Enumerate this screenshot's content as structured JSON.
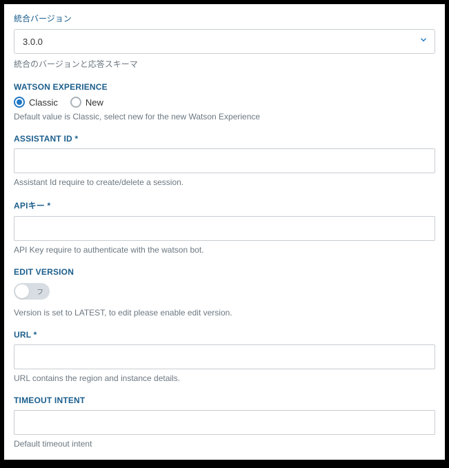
{
  "integrationVersion": {
    "label": "統合バージョン",
    "value": "3.0.0",
    "help": "統合のバージョンと応答スキーマ"
  },
  "watsonExperience": {
    "label": "WATSON EXPERIENCE",
    "options": {
      "classic": "Classic",
      "new": "New"
    },
    "selected": "classic",
    "help": "Default value is Classic, select new for the new Watson Experience"
  },
  "assistantId": {
    "label": "ASSISTANT ID *",
    "value": "",
    "help": "Assistant Id require to create/delete a session."
  },
  "apiKey": {
    "label": "APIキー *",
    "value": "",
    "help": "API Key require to authenticate with the watson bot."
  },
  "editVersion": {
    "label": "EDIT VERSION",
    "enabled": false,
    "toggleText": "フ",
    "help": "Version is set to LATEST, to edit please enable edit version."
  },
  "url": {
    "label": "URL *",
    "value": "",
    "help": "URL contains the region and instance details."
  },
  "timeoutIntent": {
    "label": "TIMEOUT INTENT",
    "value": "",
    "help": "Default timeout intent"
  }
}
